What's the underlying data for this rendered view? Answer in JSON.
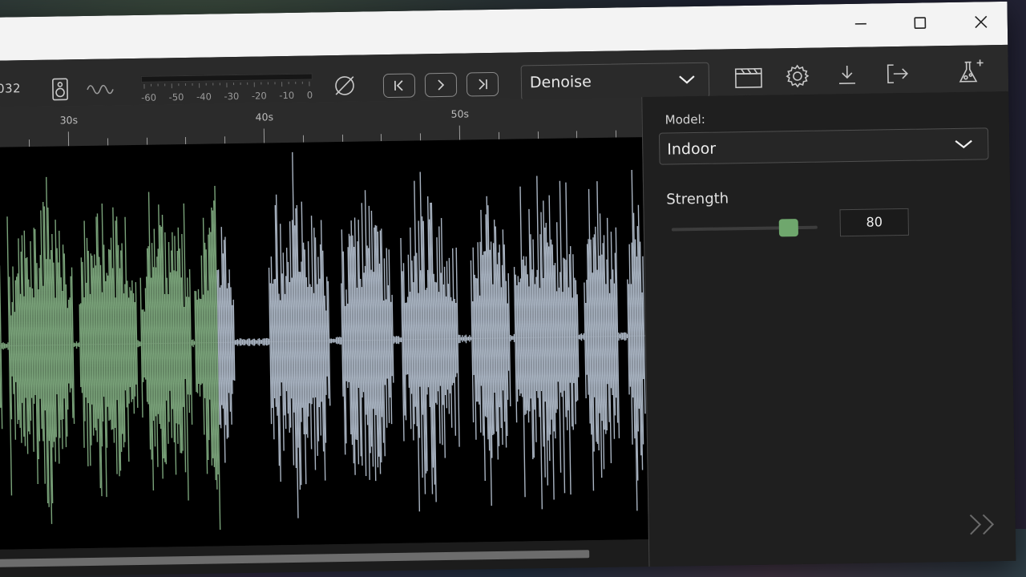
{
  "window": {
    "controls": [
      "minimize",
      "maximize",
      "close"
    ]
  },
  "toolbar": {
    "time_readout": "032",
    "meter_scale": [
      "-60",
      "-50",
      "-40",
      "-30",
      "-20",
      "-10",
      "0"
    ],
    "effect": "Denoise",
    "icons": [
      "speaker-icon",
      "waveform-icon",
      "phase-invert-icon",
      "skip-start-icon",
      "next-icon",
      "skip-end-icon",
      "clapperboard-icon",
      "gear-icon",
      "download-icon",
      "export-icon",
      "flask-icon"
    ]
  },
  "timeline": {
    "labels": [
      "30s",
      "40s",
      "50s"
    ]
  },
  "waveform": {
    "processed_color": "#7aa37a",
    "unprocessed_color": "#a9b4c2",
    "processed_fraction": 0.36
  },
  "panel": {
    "model_label": "Model:",
    "model_value": "Indoor",
    "strength_label": "Strength",
    "strength_value": "80",
    "strength_level": 0.8
  },
  "scroll": {
    "position_fraction": 0.91
  },
  "colors": {
    "accent": "#6fa76d",
    "background": "#1e1e1e"
  }
}
